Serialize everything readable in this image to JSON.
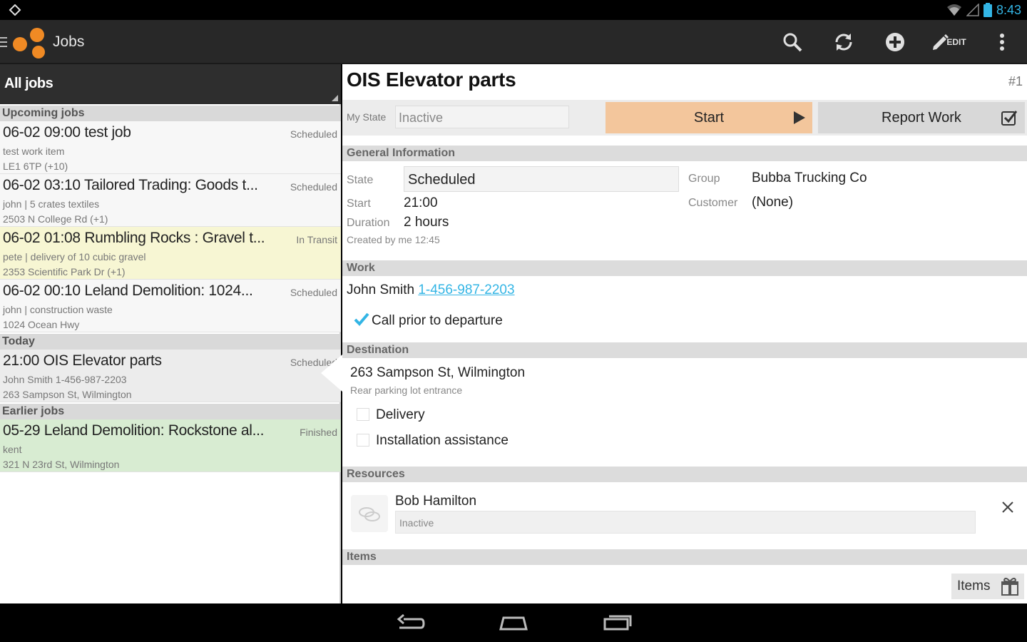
{
  "status_bar": {
    "time": "8:43"
  },
  "action_bar": {
    "title": "Jobs",
    "edit_label": "EDIT",
    "icons": [
      "search-icon",
      "refresh-icon",
      "add-icon",
      "edit-icon",
      "overflow-icon"
    ]
  },
  "job_list": {
    "filter": "All jobs",
    "sections": {
      "upcoming": "Upcoming jobs",
      "today": "Today",
      "earlier": "Earlier jobs"
    },
    "jobs": [
      {
        "title": "06-02 09:00 test job",
        "status": "Scheduled",
        "line1": "test work item",
        "line2": "LE1 6TP (+10)"
      },
      {
        "title": "06-02 03:10 Tailored Trading: Goods t...",
        "status": "Scheduled",
        "line1": "john | 5 crates textiles",
        "line2": "2503 N College Rd (+1)"
      },
      {
        "title": "06-02 01:08 Rumbling Rocks : Gravel t...",
        "status": "In Transit",
        "line1": "pete | delivery of 10 cubic gravel",
        "line2": "2353 Scientific Park Dr (+1)"
      },
      {
        "title": "06-02 00:10 Leland Demolition: 1024...",
        "status": "Scheduled",
        "line1": "john | construction waste",
        "line2": "1024 Ocean Hwy"
      },
      {
        "title": "21:00 OIS Elevator parts",
        "status": "Scheduled",
        "line1": "John Smith 1-456-987-2203",
        "line2": "263 Sampson St, Wilmington"
      },
      {
        "title": "05-29 Leland Demolition: Rockstone al...",
        "status": "Finished",
        "line1": "kent",
        "line2": "321 N 23rd St, Wilmington"
      }
    ]
  },
  "detail": {
    "title": "OIS Elevator parts",
    "number": "#1",
    "my_state_label": "My State",
    "my_state_value": "Inactive",
    "start_button": "Start",
    "report_button": "Report Work",
    "sections": {
      "general": "General Information",
      "work": "Work",
      "destination": "Destination",
      "resources": "Resources",
      "items": "Items"
    },
    "general": {
      "state_label": "State",
      "state_value": "Scheduled",
      "start_label": "Start",
      "start_value": "21:00",
      "duration_label": "Duration",
      "duration_value": "2 hours",
      "created": "Created by me 12:45",
      "group_label": "Group",
      "group_value": "Bubba Trucking Co",
      "customer_label": "Customer",
      "customer_value": "(None)"
    },
    "work": {
      "contact": "John Smith",
      "phone": "1-456-987-2203",
      "checklist": "Call prior to departure"
    },
    "destination": {
      "address": "263 Sampson St, Wilmington",
      "note": "Rear parking lot entrance",
      "options": [
        "Delivery",
        "Installation assistance"
      ]
    },
    "resources": [
      {
        "name": "Bob Hamilton",
        "state": "Inactive"
      }
    ],
    "items_button": "Items"
  },
  "colors": {
    "accent": "#33b5e5",
    "start_button": "#f3c69c",
    "transit_row": "#f7f6d3",
    "finished_row": "#d8ecd2",
    "logo_orange": "#f08a24"
  }
}
